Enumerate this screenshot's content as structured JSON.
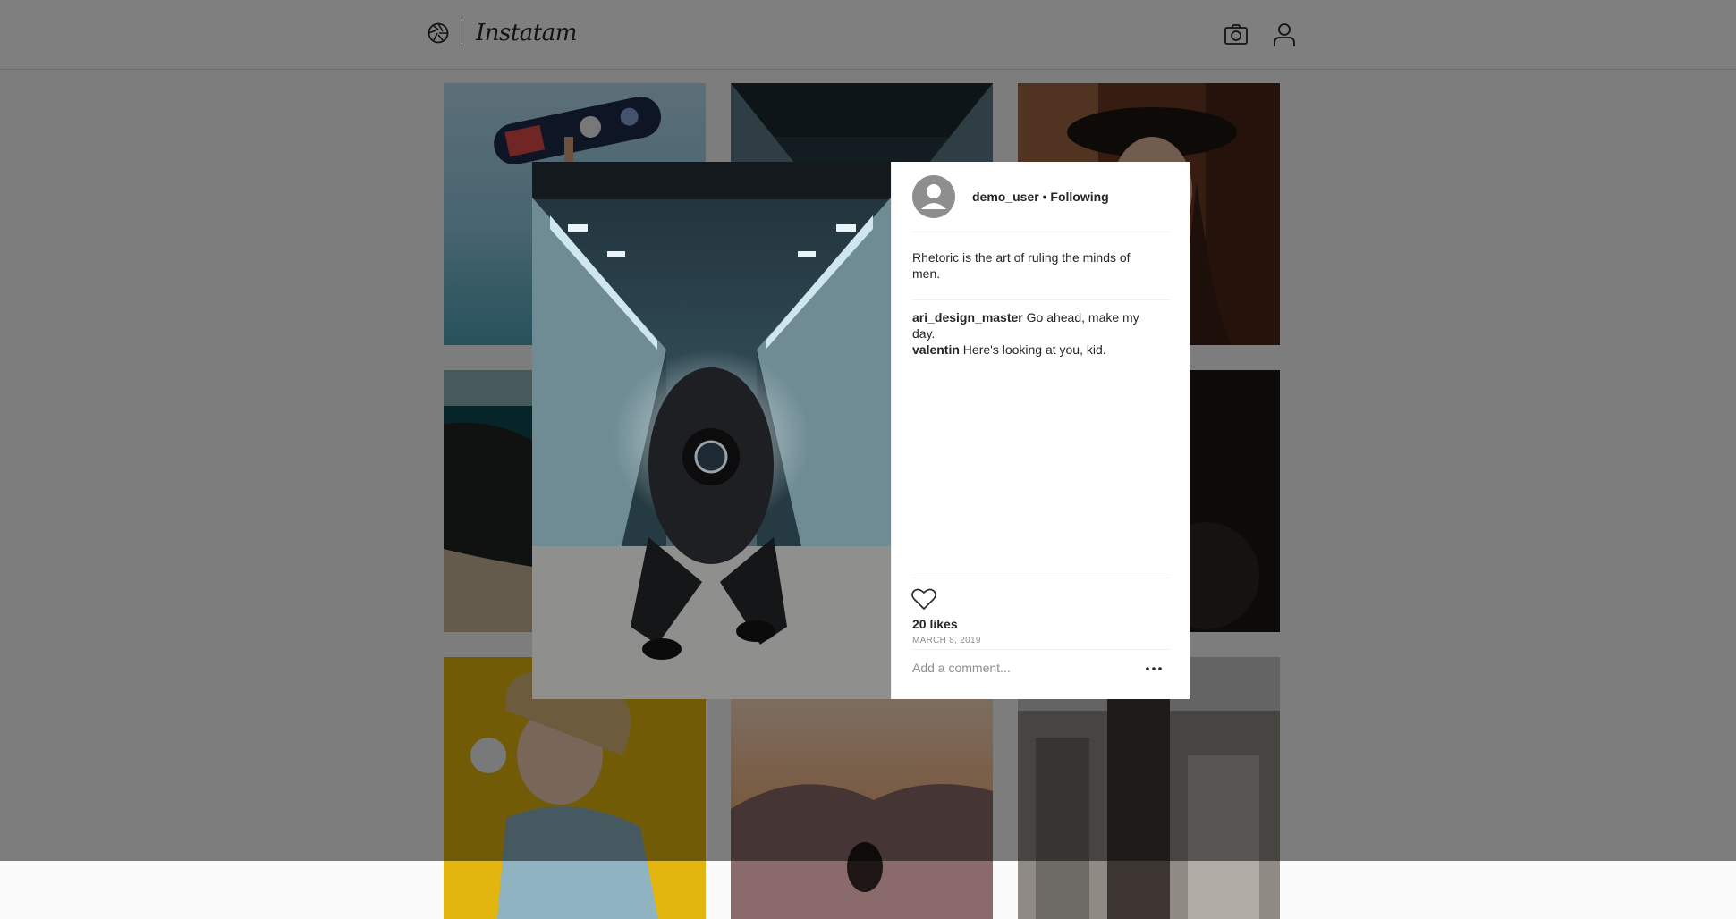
{
  "header": {
    "brand": "Instatam",
    "logo_icon": "aperture-icon",
    "camera_icon": "camera-icon",
    "profile_icon": "user-icon"
  },
  "grid": {
    "tiles": [
      {
        "name": "wakeboard-photo"
      },
      {
        "name": "subway-photo"
      },
      {
        "name": "woman-hat-photo"
      },
      {
        "name": "coast-photo"
      },
      {
        "name": "woman-portrait-photo"
      },
      {
        "name": "dancing-girl-photo"
      },
      {
        "name": "mountain-sunset-photo"
      },
      {
        "name": "city-aerial-photo"
      }
    ]
  },
  "modal": {
    "author": "demo_user",
    "separator": "•",
    "follow_status": "Following",
    "caption": "Rhetoric is the art of ruling the minds of men.",
    "comments": [
      {
        "user": "ari_design_master",
        "text": "Go ahead, make my day."
      },
      {
        "user": "valentin",
        "text": "Here's looking at you, kid."
      }
    ],
    "likes": "20 likes",
    "date": "MARCH 8, 2019",
    "comment_placeholder": "Add a comment...",
    "more_label": "..."
  },
  "colors": {
    "text": "#262626",
    "muted": "#8e8e8e",
    "border": "#efefef",
    "overlay": "rgba(0,0,0,0.5)"
  }
}
